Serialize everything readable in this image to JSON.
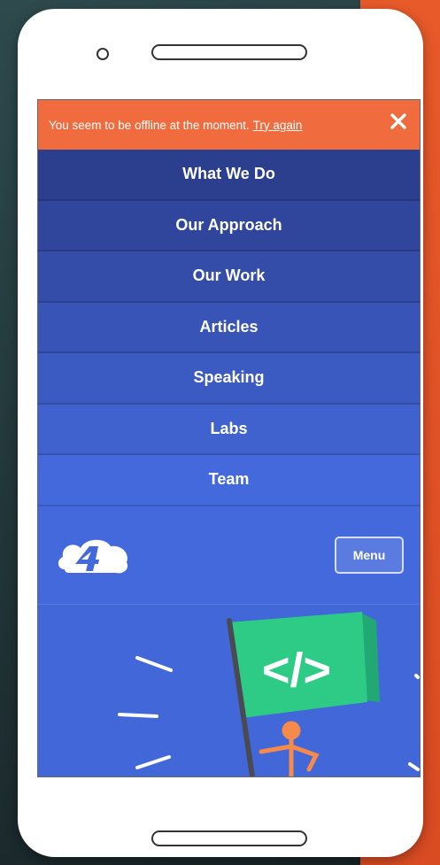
{
  "offline_banner": {
    "message": "You seem to be offline at the moment.",
    "retry_label": "Try again",
    "close_icon": "close-icon"
  },
  "nav": {
    "items": [
      {
        "label": "What We Do"
      },
      {
        "label": "Our Approach"
      },
      {
        "label": "Our Work"
      },
      {
        "label": "Articles"
      },
      {
        "label": "Speaking"
      },
      {
        "label": "Labs"
      },
      {
        "label": "Team"
      }
    ]
  },
  "header": {
    "logo_icon": "four-logo-icon",
    "menu_label": "Menu"
  },
  "hero": {
    "illustration": "flag-code-icon",
    "flag_glyph": "</>"
  },
  "colors": {
    "banner": "#f06b3e",
    "nav_top": "#2c3f8f",
    "nav_bottom": "#4469dc",
    "flag": "#2ecb86",
    "figure": "#f58a4b"
  }
}
